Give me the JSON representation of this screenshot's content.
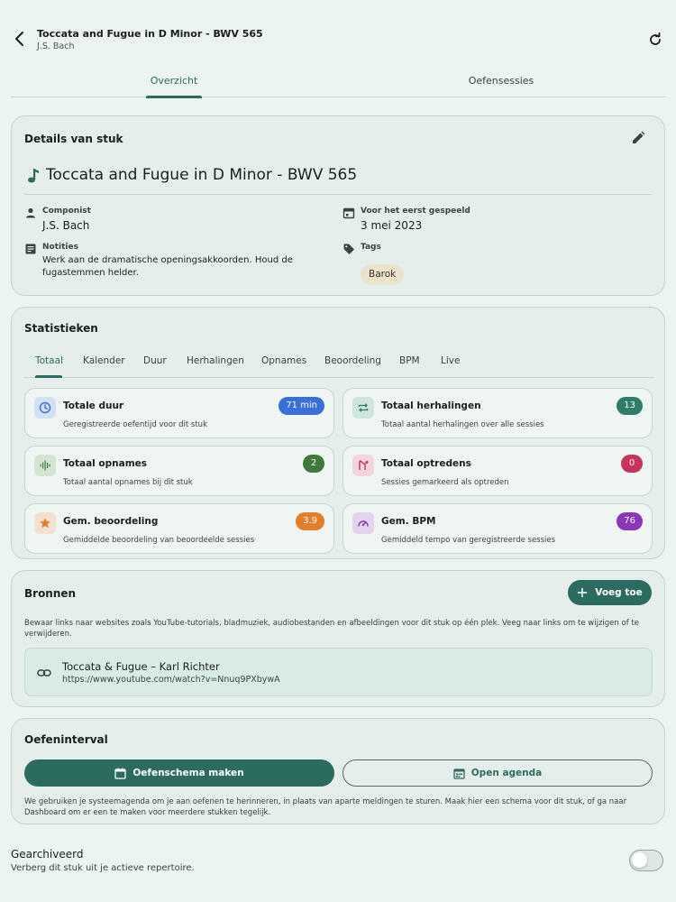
{
  "header": {
    "title": "Toccata and Fugue in D Minor - BWV 565",
    "subtitle": "J.S. Bach",
    "back_icon": "arrow-back-icon",
    "refresh_icon": "refresh-icon"
  },
  "tabs": [
    {
      "label": "Overzicht",
      "active": true
    },
    {
      "label": "Oefensessies",
      "active": false
    }
  ],
  "details": {
    "heading": "Details van stuk",
    "piece_title": "Toccata and Fugue in D Minor - BWV 565",
    "composer_label": "Componist",
    "composer_value": "J.S. Bach",
    "first_played_label": "Voor het eerst gespeeld",
    "first_played_value": "3 mei 2023",
    "notes_label": "Notities",
    "notes_value": "Werk aan de dramatische openingsakkoorden. Houd de fugastemmen helder.",
    "tags_label": "Tags",
    "tags": [
      "Barok"
    ]
  },
  "stats": {
    "heading": "Statistieken",
    "tabs": [
      "Totaal",
      "Kalender",
      "Duur",
      "Herhalingen",
      "Opnames",
      "Beoordeling",
      "BPM",
      "Live"
    ],
    "active_tab": "Totaal",
    "items": [
      {
        "title": "Totale duur",
        "desc": "Geregistreerde oefentijd voor dit stuk",
        "value": "71 min",
        "icon": "clock-icon",
        "color": "#3a6fd6"
      },
      {
        "title": "Totaal herhalingen",
        "desc": "Totaal aantal herhalingen over alle sessies",
        "value": "13",
        "icon": "repeat-icon",
        "color": "#2f7c6b"
      },
      {
        "title": "Totaal opnames",
        "desc": "Totaal aantal opnames bij dit stuk",
        "value": "2",
        "icon": "waveform-icon",
        "color": "#3f7a3a"
      },
      {
        "title": "Totaal optredens",
        "desc": "Sessies gemarkeerd als optreden",
        "value": "0",
        "icon": "performance-icon",
        "color": "#c7335a"
      },
      {
        "title": "Gem. beoordeling",
        "desc": "Gemiddelde beoordeling van beoordeelde sessies",
        "value": "3.9",
        "icon": "star-icon",
        "color": "#e07f2c"
      },
      {
        "title": "Gem. BPM",
        "desc": "Gemiddeld tempo van geregistreerde sessies",
        "value": "76",
        "icon": "speedometer-icon",
        "color": "#8a36b8"
      }
    ]
  },
  "sources": {
    "heading": "Bronnen",
    "add_label": "Voeg toe",
    "description": "Bewaar links naar websites zoals YouTube-tutorials, bladmuziek, audiobestanden en afbeeldingen voor dit stuk op één plek. Veeg naar links om te wijzigen of te verwijderen.",
    "items": [
      {
        "title": "Toccata & Fugue – Karl Richter",
        "url": "https://www.youtube.com/watch?v=Nnuq9PXbywA"
      }
    ]
  },
  "interval": {
    "heading": "Oefeninterval",
    "primary_label": "Oefenschema maken",
    "secondary_label": "Open agenda",
    "description": "We gebruiken je systeemagenda om je aan oefenen te herinneren, in plaats van aparte meldingen te sturen. Maak hier een schema voor dit stuk, of ga naar Dashboard om er een te maken voor meerdere stukken tegelijk."
  },
  "archive": {
    "title": "Gearchiveerd",
    "subtitle": "Verberg dit stuk uit je actieve repertoire.",
    "enabled": false
  },
  "colors": {
    "accent": "#2c6b5f",
    "background": "#ecf4f1",
    "card": "#e4eeeb"
  }
}
